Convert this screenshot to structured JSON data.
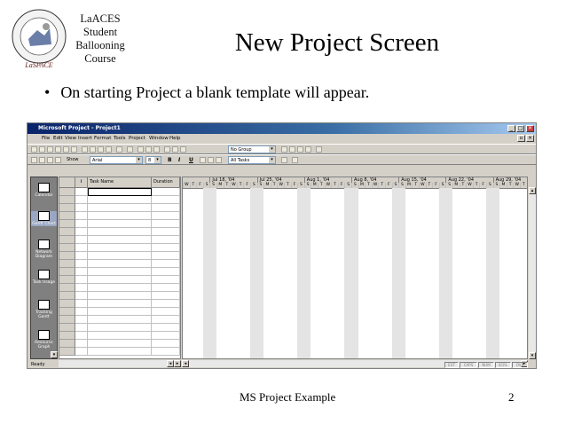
{
  "slide": {
    "logo_lines": [
      "LaACES",
      "Student",
      "Ballooning",
      "Course"
    ],
    "title": "New Project Screen",
    "bullet": "On starting Project a blank template will appear.",
    "footer": "MS Project Example",
    "page_number": "2"
  },
  "app": {
    "window_title": "Microsoft Project - Project1",
    "menu": [
      "File",
      "Edit",
      "View",
      "Insert",
      "Format",
      "Tools",
      "Project",
      "Window",
      "Help"
    ],
    "toolbar": {
      "group_combo": "No Group",
      "show_label": "Show",
      "font_combo": "Arial",
      "size_combo": "8",
      "bold": "B",
      "italic": "I",
      "underline": "U",
      "filter_combo": "All Tasks"
    },
    "view_bar": [
      {
        "label": "Calendar",
        "selected": false
      },
      {
        "label": "Gantt Chart",
        "selected": true
      },
      {
        "label": "Network Diagram",
        "selected": false
      },
      {
        "label": "Task Usage",
        "selected": false
      },
      {
        "label": "Tracking Gantt",
        "selected": false
      },
      {
        "label": "Resource Graph",
        "selected": false
      }
    ],
    "grid": {
      "columns": [
        "",
        "i",
        "Task Name",
        "Duration"
      ]
    },
    "gantt": {
      "weeks": [
        "Jul 18, '04",
        "Jul 25, '04",
        "Aug 1, '04",
        "Aug 8, '04",
        "Aug 15, '04",
        "Aug 22, '04",
        "Aug 29, '04"
      ],
      "first_days": [
        "W",
        "T",
        "F",
        "S"
      ],
      "week_days": [
        "S",
        "M",
        "T",
        "W",
        "T",
        "F",
        "S"
      ]
    },
    "status": {
      "text": "Ready",
      "indicators": [
        "EXT",
        "CAPS",
        "NUM",
        "SCRL",
        "OVR"
      ]
    }
  }
}
